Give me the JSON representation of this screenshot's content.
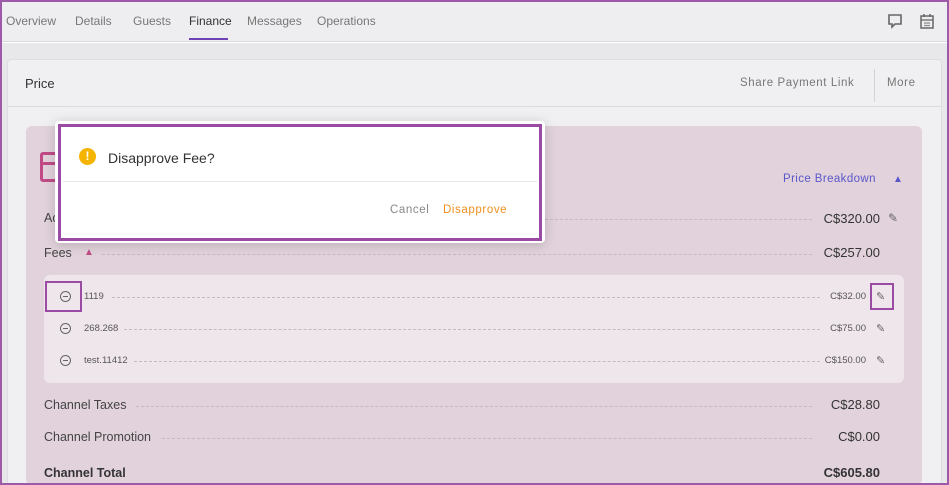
{
  "tabs": [
    {
      "label": "Overview"
    },
    {
      "label": "Details"
    },
    {
      "label": "Guests"
    },
    {
      "label": "Finance"
    },
    {
      "label": "Messages"
    },
    {
      "label": "Operations"
    }
  ],
  "active_tab": "Finance",
  "header": {
    "title": "Price",
    "share_label": "Share Payment Link",
    "more_label": "More"
  },
  "card": {
    "breakdown_label": "Price Breakdown",
    "accommodation_label": "Ac",
    "accommodation_value": "C$320.00",
    "fees_label": "Fees",
    "fees_value": "C$257.00",
    "fees": [
      {
        "name": "1119",
        "value": "C$32.00"
      },
      {
        "name": "268.268",
        "value": "C$75.00"
      },
      {
        "name": "test.11412",
        "value": "C$150.00"
      }
    ],
    "channel_taxes_label": "Channel Taxes",
    "channel_taxes_value": "C$28.80",
    "channel_promotion_label": "Channel Promotion",
    "channel_promotion_value": "C$0.00",
    "channel_total_label": "Channel Total",
    "channel_total_value": "C$605.80"
  },
  "modal": {
    "title": "Disapprove Fee?",
    "cancel_label": "Cancel",
    "confirm_label": "Disapprove",
    "warning_glyph": "!"
  },
  "colors": {
    "accent": "#6f43b6",
    "card_bg": "#e2d2dc",
    "brand_pink": "#c14b86",
    "link_blue": "#5a58c8",
    "warning": "#f5b400",
    "confirm_orange": "#ef8f1e",
    "highlight": "#9b4ba3"
  }
}
